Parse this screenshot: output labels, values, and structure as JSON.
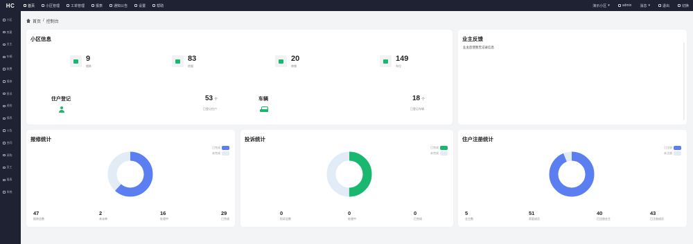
{
  "app": {
    "logo": "HC"
  },
  "topnav": [
    {
      "label": "首页",
      "icon": "home-icon",
      "active": true
    },
    {
      "label": "小区管理",
      "icon": "building-icon",
      "active": false
    },
    {
      "label": "工单管理",
      "icon": "order-icon",
      "active": false
    },
    {
      "label": "报表",
      "icon": "chart-icon",
      "active": false
    },
    {
      "label": "通知公告",
      "icon": "notice-icon",
      "active": false
    },
    {
      "label": "设置",
      "icon": "gear-icon",
      "active": false
    },
    {
      "label": "帮助",
      "icon": "help-icon",
      "active": false
    }
  ],
  "topright": [
    {
      "label": "演示小区",
      "icon": "community-icon"
    },
    {
      "label": "admin",
      "icon": "user-icon"
    },
    {
      "label": "消息",
      "icon": "bell-icon"
    },
    {
      "label": "退出",
      "icon": "logout-icon"
    },
    {
      "label": "切换",
      "icon": "switch-icon"
    }
  ],
  "sidebar": [
    "小区",
    "房屋",
    "业主",
    "车辆",
    "收费",
    "报修",
    "投诉",
    "巡检",
    "保养",
    "公告",
    "合同",
    "采购",
    "员工",
    "报表",
    "系统"
  ],
  "breadcrumb": {
    "home": "首页",
    "sep": "/",
    "current": "控制台"
  },
  "community": {
    "title": "小区信息",
    "stats": [
      {
        "value": "9",
        "label": "楼栋",
        "icon": "building-icon"
      },
      {
        "value": "83",
        "label": "房屋",
        "icon": "house-icon"
      },
      {
        "value": "20",
        "label": "商铺",
        "icon": "shop-icon"
      },
      {
        "value": "149",
        "label": "车位",
        "icon": "truck-icon"
      }
    ],
    "owner": {
      "title": "住户登记",
      "value": "53",
      "unit": "个",
      "label": "已登记住户"
    },
    "car": {
      "title": "车辆",
      "value": "18",
      "unit": "个",
      "label": "已登记车辆"
    }
  },
  "feedback": {
    "title": "业主反馈",
    "text": "业主反馈暂无记录信息"
  },
  "colors": {
    "primary": "#5b7ff0",
    "green": "#1ab76e",
    "light": "#e2ecf7"
  },
  "charts": [
    {
      "title": "报修统计",
      "legend": [
        "已完成",
        "未完成"
      ],
      "kpis": [
        {
          "value": "47",
          "label": "报修总数"
        },
        {
          "value": "2",
          "label": "未派单"
        },
        {
          "value": "16",
          "label": "处理中"
        },
        {
          "value": "29",
          "label": "已完成"
        }
      ]
    },
    {
      "title": "投诉统计",
      "legend": [
        "已完成",
        "未完成"
      ],
      "kpis": [
        {
          "value": "0",
          "label": "投诉总数"
        },
        {
          "value": "0",
          "label": "处理中"
        },
        {
          "value": "0",
          "label": "已完成"
        }
      ]
    },
    {
      "title": "住户注册统计",
      "legend": [
        "已注册",
        "未注册"
      ],
      "kpis": [
        {
          "value": "5",
          "label": "业主数"
        },
        {
          "value": "51",
          "label": "家庭成员"
        },
        {
          "value": "40",
          "label": "已注册业主"
        },
        {
          "value": "43",
          "label": "已注册成员"
        }
      ]
    }
  ],
  "chart_data": [
    {
      "type": "pie",
      "title": "报修统计",
      "categories": [
        "已完成",
        "未完成"
      ],
      "values": [
        29,
        18
      ]
    },
    {
      "type": "pie",
      "title": "投诉统计",
      "categories": [
        "已完成",
        "未完成"
      ],
      "values": [
        0,
        0
      ]
    },
    {
      "type": "pie",
      "title": "住户注册统计",
      "categories": [
        "已注册",
        "未注册"
      ],
      "values": [
        91,
        6
      ]
    }
  ]
}
